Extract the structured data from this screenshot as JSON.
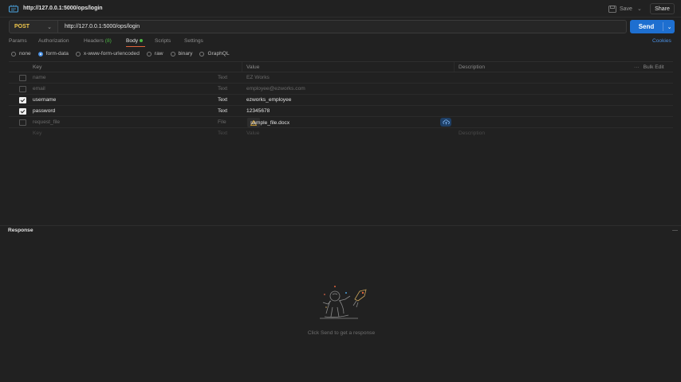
{
  "tab": {
    "title": "http://127.0.0.1:5000/ops/login"
  },
  "header": {
    "save_label": "Save",
    "share_label": "Share"
  },
  "request": {
    "method": "POST",
    "url": "http://127.0.0.1:5000/ops/login",
    "send_label": "Send"
  },
  "tabs": {
    "params": "Params",
    "authorization": "Authorization",
    "headers": "Headers",
    "headers_count": "(8)",
    "body": "Body",
    "scripts": "Scripts",
    "settings": "Settings",
    "cookies": "Cookies"
  },
  "body_types": [
    "none",
    "form-data",
    "x-www-form-urlencoded",
    "raw",
    "binary",
    "GraphQL"
  ],
  "selected_body_type": "form-data",
  "table": {
    "headers": {
      "key": "Key",
      "value": "Value",
      "description": "Description",
      "bulk_edit": "Bulk Edit",
      "more": "···"
    },
    "rows": [
      {
        "key": "name",
        "type": "Text",
        "value": "EZ Works",
        "checked": false
      },
      {
        "key": "email",
        "type": "Text",
        "value": "employee@ezworks.com",
        "checked": false
      },
      {
        "key": "username",
        "type": "Text",
        "value": "ezworks_employee",
        "checked": true
      },
      {
        "key": "password",
        "type": "Text",
        "value": "12345678",
        "checked": true
      },
      {
        "key": "request_file",
        "type": "File",
        "value": "sample_file.docx",
        "checked": false
      }
    ],
    "placeholder": {
      "key": "Key",
      "type": "Text",
      "value": "Value",
      "description": "Description"
    }
  },
  "response": {
    "label": "Response",
    "empty_message": "Click Send to get a response",
    "collapse": "—"
  },
  "colors": {
    "accent": "#1e6fd0",
    "method": "#f2c94c",
    "active_tab_underline": "#e0643c",
    "badge": "#4bb543"
  }
}
